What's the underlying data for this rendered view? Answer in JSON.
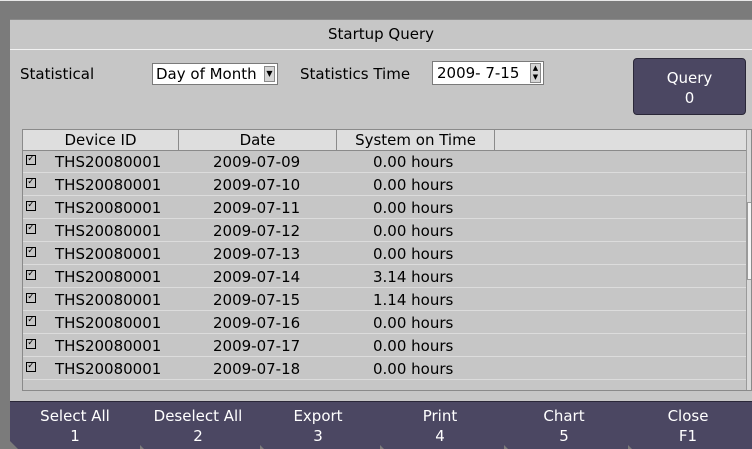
{
  "window": {
    "title": "Startup Query"
  },
  "filters": {
    "statistical_label": "Statistical",
    "statistical_value": "Day of Month",
    "time_label": "Statistics Time",
    "time_value": "2009- 7-15"
  },
  "query_button": {
    "label": "Query",
    "key": "0"
  },
  "table": {
    "columns": [
      "Device ID",
      "Date",
      "System on Time"
    ],
    "rows": [
      {
        "checked": true,
        "device": "THS20080001",
        "date": "2009-07-09",
        "time": "0.00 hours"
      },
      {
        "checked": true,
        "device": "THS20080001",
        "date": "2009-07-10",
        "time": "0.00 hours"
      },
      {
        "checked": true,
        "device": "THS20080001",
        "date": "2009-07-11",
        "time": "0.00 hours"
      },
      {
        "checked": true,
        "device": "THS20080001",
        "date": "2009-07-12",
        "time": "0.00 hours"
      },
      {
        "checked": true,
        "device": "THS20080001",
        "date": "2009-07-13",
        "time": "0.00 hours"
      },
      {
        "checked": true,
        "device": "THS20080001",
        "date": "2009-07-14",
        "time": "3.14 hours"
      },
      {
        "checked": true,
        "device": "THS20080001",
        "date": "2009-07-15",
        "time": "1.14 hours"
      },
      {
        "checked": true,
        "device": "THS20080001",
        "date": "2009-07-16",
        "time": "0.00 hours"
      },
      {
        "checked": true,
        "device": "THS20080001",
        "date": "2009-07-17",
        "time": "0.00 hours"
      },
      {
        "checked": true,
        "device": "THS20080001",
        "date": "2009-07-18",
        "time": "0.00 hours"
      }
    ]
  },
  "toolbar": [
    {
      "label": "Select All",
      "key": "1"
    },
    {
      "label": "Deselect All",
      "key": "2"
    },
    {
      "label": "Export",
      "key": "3"
    },
    {
      "label": "Print",
      "key": "4"
    },
    {
      "label": "Chart",
      "key": "5"
    },
    {
      "label": "Close",
      "key": "F1"
    }
  ],
  "icons": {
    "dropdown": "dropdown-arrow-icon",
    "spinner": "spinner-icon",
    "checkbox": "checkbox-icon"
  },
  "colors": {
    "button_bg": "#4b4762",
    "window_bg": "#c6c6c6",
    "frame": "#7b7b7b"
  }
}
